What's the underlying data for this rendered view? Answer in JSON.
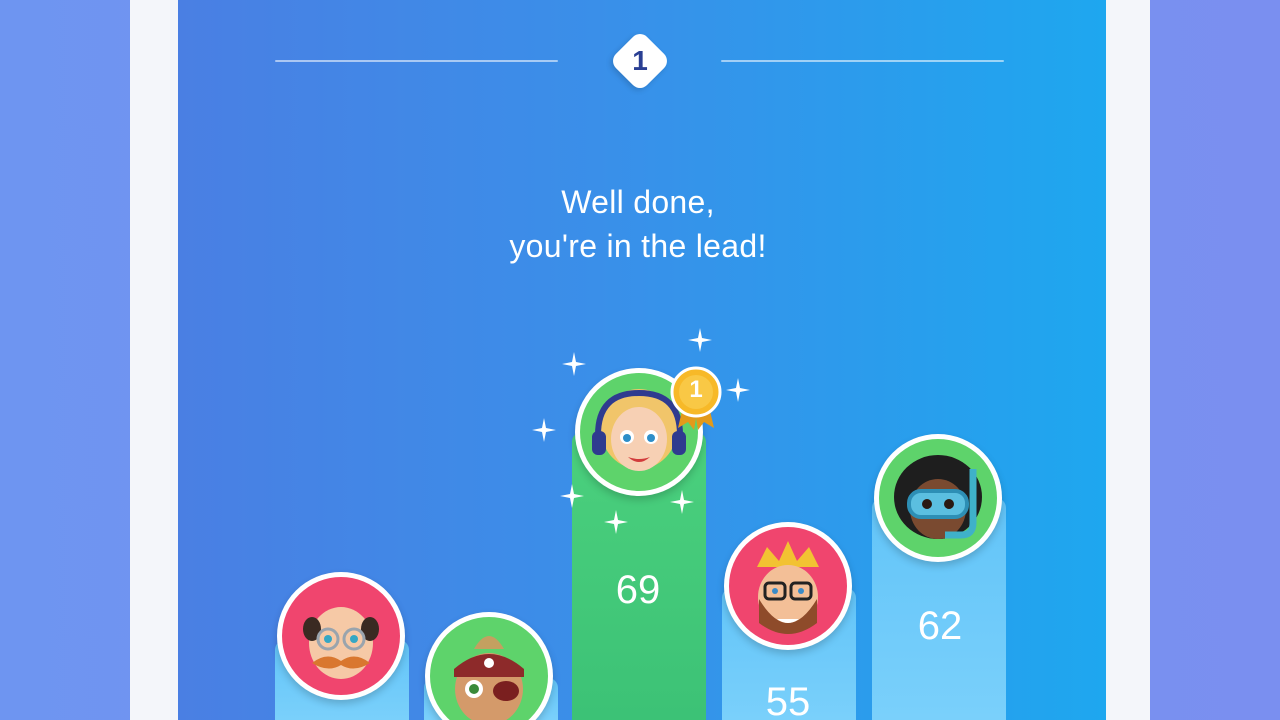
{
  "round": {
    "number": "1"
  },
  "headline": {
    "line1": "Well done,",
    "line2": "you're in the lead!"
  },
  "leader_medal": {
    "number": "1"
  },
  "players": [
    {
      "id": "old-man-mustache",
      "icon": "bald-mustache-glasses-avatar",
      "ring_color": "#f0456e",
      "column_color": "blue",
      "score": ""
    },
    {
      "id": "pirate",
      "icon": "pirate-eyepatch-avatar",
      "ring_color": "#5ed36b",
      "column_color": "blue",
      "score": ""
    },
    {
      "id": "blonde-headphones",
      "icon": "blonde-headphones-avatar",
      "ring_color": "#5ed36b",
      "column_color": "green",
      "score": "69"
    },
    {
      "id": "king-bearded",
      "icon": "crowned-bearded-glasses-avatar",
      "ring_color": "#f0456e",
      "column_color": "blue",
      "score": "55"
    },
    {
      "id": "snorkel-diver",
      "icon": "snorkel-diver-avatar",
      "ring_color": "#5ed36b",
      "column_color": "blue",
      "score": "62"
    }
  ],
  "colors": {
    "panel_start": "#4a7fe3",
    "panel_end": "#1ea7ef",
    "leader_column": "#3cc276",
    "other_column": "#6fcbfa",
    "medal_gold": "#f7b928"
  }
}
